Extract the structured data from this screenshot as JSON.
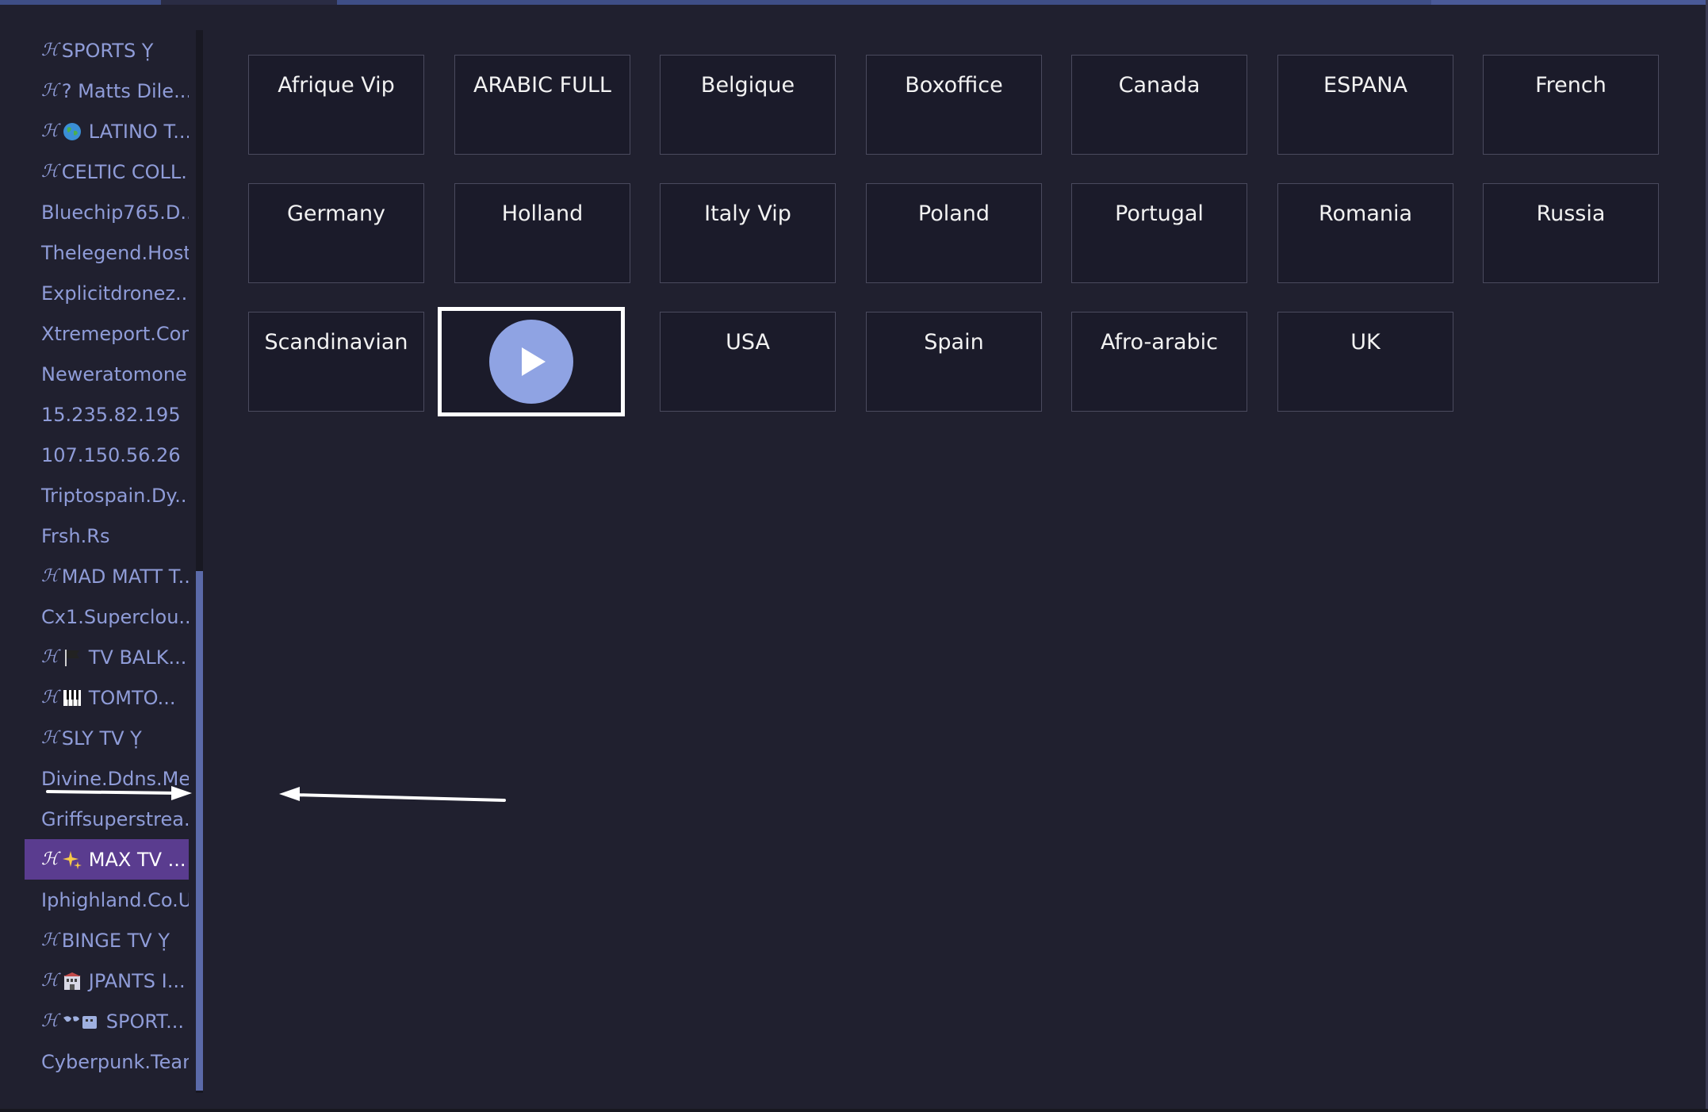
{
  "colors": {
    "background": "#20202f",
    "sidebar_text": "#8f9cd8",
    "selected_bg": "#5a3c8f",
    "tile_bg": "#1b1b2a",
    "tile_border": "#4a4a5e",
    "play_button": "#8fa3e3",
    "scroll_thumb": "#5b6aa9"
  },
  "sidebar": {
    "items": [
      {
        "label": "SPORTS Ỵ",
        "prefix": "ℋ",
        "icon": ""
      },
      {
        "label": "?  Matts Dile...",
        "prefix": "ℋ",
        "icon": ""
      },
      {
        "label": "LATINO T...",
        "prefix": "ℋ",
        "icon": "globe-icon"
      },
      {
        "label": "CELTIC COLL...",
        "prefix": "ℋ",
        "icon": ""
      },
      {
        "label": "Bluechip765.D...",
        "prefix": "",
        "icon": ""
      },
      {
        "label": "Thelegend.Host",
        "prefix": "",
        "icon": ""
      },
      {
        "label": "Explicitdronez....",
        "prefix": "",
        "icon": ""
      },
      {
        "label": "Xtremeport.Com",
        "prefix": "",
        "icon": ""
      },
      {
        "label": "Neweratomone...",
        "prefix": "",
        "icon": ""
      },
      {
        "label": "15.235.82.195",
        "prefix": "",
        "icon": ""
      },
      {
        "label": "107.150.56.26",
        "prefix": "",
        "icon": ""
      },
      {
        "label": "Triptospain.Dy...",
        "prefix": "",
        "icon": ""
      },
      {
        "label": "Frsh.Rs",
        "prefix": "",
        "icon": ""
      },
      {
        "label": "MAD MATT T...",
        "prefix": "ℋ",
        "icon": ""
      },
      {
        "label": "Cx1.Superclou...",
        "prefix": "",
        "icon": ""
      },
      {
        "label": "TV BALK...",
        "prefix": "ℋ",
        "icon": "flag-icon"
      },
      {
        "label": "TOMTO...",
        "prefix": "ℋ",
        "icon": "piano-icon"
      },
      {
        "label": "SLY TV Ỵ",
        "prefix": "ℋ",
        "icon": ""
      },
      {
        "label": "Divine.Ddns.Me",
        "prefix": "",
        "icon": ""
      },
      {
        "label": "Griffsuperstrea...",
        "prefix": "",
        "icon": ""
      },
      {
        "label": "MAX TV ...",
        "prefix": "ℋ",
        "icon": "sparkles-icon",
        "selected": true
      },
      {
        "label": "Iphighland.Co.Uk",
        "prefix": "",
        "icon": ""
      },
      {
        "label": "BINGE TV  Ỵ",
        "prefix": "ℋ",
        "icon": ""
      },
      {
        "label": "JPANTS I...",
        "prefix": "ℋ",
        "icon": "building-icon"
      },
      {
        "label": "SPORT...",
        "prefix": "ℋ",
        "icon": "world-map-icon"
      },
      {
        "label": "Cyberpunk.Team",
        "prefix": "",
        "icon": ""
      }
    ]
  },
  "grid": {
    "tiles": [
      "Afrique Vip",
      "ARABIC FULL",
      "Belgique",
      "Boxoffice",
      "Canada",
      "ESPANA",
      "French",
      "Germany",
      "Holland",
      "Italy Vip",
      "Poland",
      "Portugal",
      "Romania",
      "Russia",
      "Scandinavian",
      "",
      "USA",
      "Spain",
      "Afro-arabic",
      "UK"
    ],
    "focused_index": 15,
    "focused_icon": "play-icon"
  },
  "annotations": {
    "arrows": [
      "right-arrow-icon",
      "left-arrow-icon"
    ]
  }
}
